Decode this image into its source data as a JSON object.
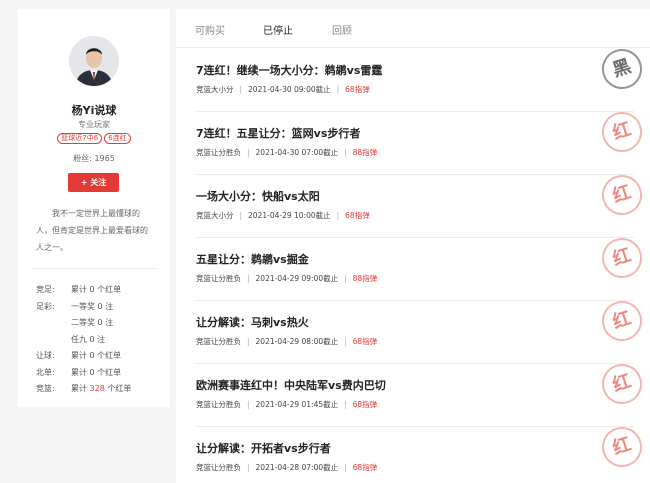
{
  "profile": {
    "name": "杨Yi说球",
    "title": "专业玩家",
    "tags": [
      "篮球近7中6",
      "6连红"
    ],
    "fans_label": "粉丝:",
    "fans_count": "1965",
    "follow_label": "+ 关注",
    "bio": "我不一定世界上最懂球的人，但肯定是世界上最爱看球的人之一。",
    "stats": [
      {
        "label": "竞足:",
        "value": "累计 0 个红单"
      },
      {
        "label": "足彩:",
        "value": "一等奖 0 注"
      },
      {
        "label": "",
        "value": "二等奖 0 注"
      },
      {
        "label": "",
        "value": "任九 0 注"
      },
      {
        "label": "让球:",
        "value": "累计 0 个红单"
      },
      {
        "label": "北单:",
        "value": "累计 0 个红单"
      },
      {
        "label": "竞篮:",
        "value_prefix": "累计 ",
        "value_highlight": "328",
        "value_suffix": " 个红单"
      }
    ]
  },
  "tabs": [
    {
      "label": "可购买",
      "active": false
    },
    {
      "label": "已停止",
      "active": true
    },
    {
      "label": "回顾",
      "active": false
    }
  ],
  "articles": [
    {
      "headline": "7连红！继续一场大小分：鹈鹕vs雷霆",
      "category": "竞篮大小分",
      "deadline": "2021-04-30 09:00截止",
      "price": "68指弹",
      "stamp": "黑"
    },
    {
      "headline": "7连红！五星让分：篮网vs步行者",
      "category": "竞篮让分胜负",
      "deadline": "2021-04-30 07:00截止",
      "price": "88指弹",
      "stamp": "红"
    },
    {
      "headline": "一场大小分：快船vs太阳",
      "category": "竞篮大小分",
      "deadline": "2021-04-29 10:00截止",
      "price": "68指弹",
      "stamp": "红"
    },
    {
      "headline": "五星让分：鹈鹕vs掘金",
      "category": "竞篮让分胜负",
      "deadline": "2021-04-29 09:00截止",
      "price": "88指弹",
      "stamp": "红"
    },
    {
      "headline": "让分解读：马刺vs热火",
      "category": "竞篮让分胜负",
      "deadline": "2021-04-29 08:00截止",
      "price": "68指弹",
      "stamp": "红"
    },
    {
      "headline": "欧洲赛事连红中！中央陆军vs费内巴切",
      "category": "竞篮让分胜负",
      "deadline": "2021-04-29 01:45截止",
      "price": "68指弹",
      "stamp": "红"
    },
    {
      "headline": "让分解读：开拓者vs步行者",
      "category": "竞篮让分胜负",
      "deadline": "2021-04-28 07:00截止",
      "price": "68指弹",
      "stamp": "红"
    }
  ],
  "colors": {
    "accent": "#e53935",
    "stamp_red": "#ec7d73",
    "stamp_black": "#5a5a5a"
  }
}
